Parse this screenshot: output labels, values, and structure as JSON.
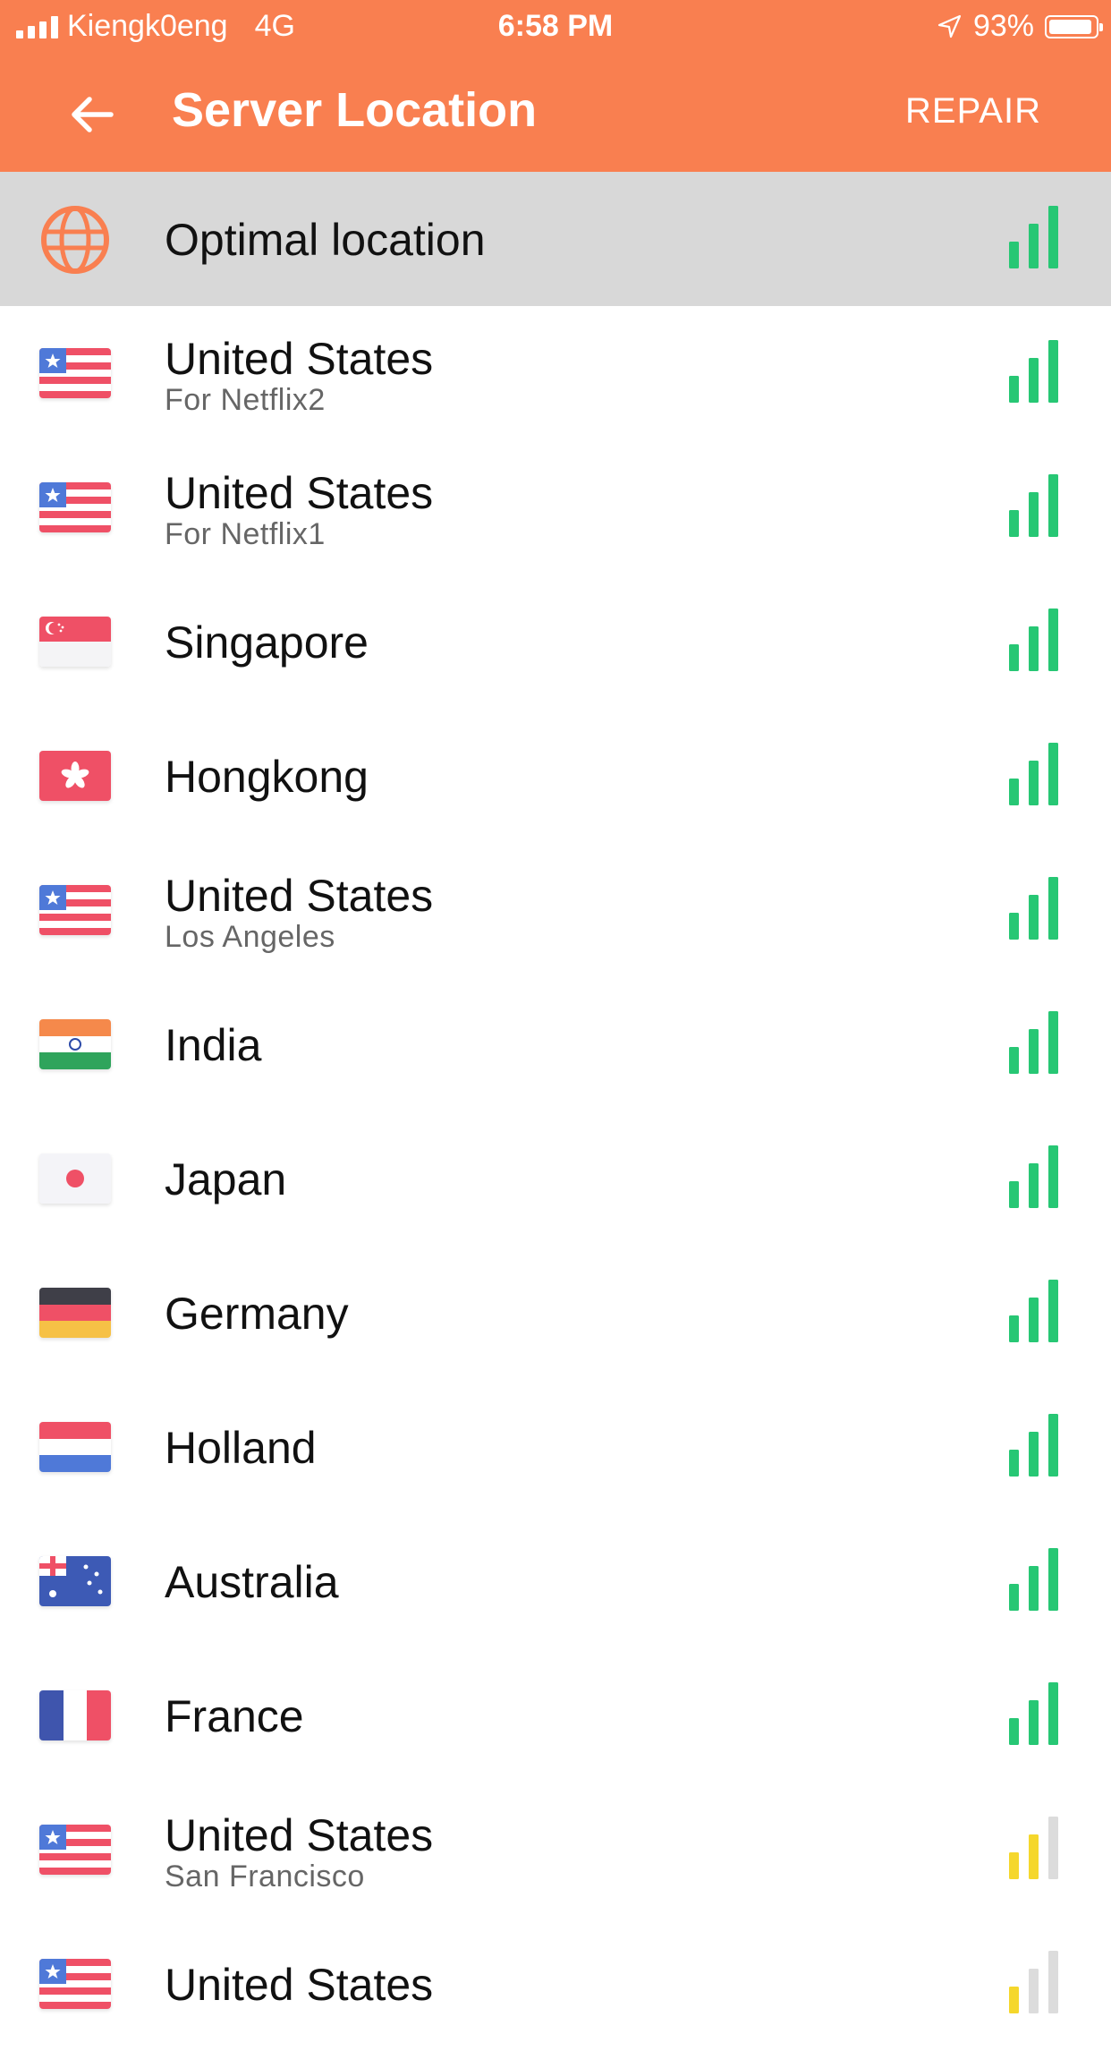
{
  "status_bar": {
    "carrier": "Kiengk0eng",
    "network": "4G",
    "time": "6:58 PM",
    "battery": "93%",
    "battery_level": 0.93
  },
  "header": {
    "title": "Server Location",
    "action": "REPAIR"
  },
  "colors": {
    "accent": "#f97f50",
    "signal_green": "#27c774",
    "signal_yellow": "#f5d72c",
    "signal_off": "#dcdcdc",
    "selected_row": "#d8d8d8"
  },
  "locations": [
    {
      "name": "Optimal location",
      "sub": "",
      "icon": "globe-icon",
      "signal": "good",
      "selected": true
    },
    {
      "name": "United States",
      "sub": "For Netflix2",
      "icon": "us-flag",
      "signal": "good"
    },
    {
      "name": "United States",
      "sub": "For Netflix1",
      "icon": "us-flag",
      "signal": "good"
    },
    {
      "name": "Singapore",
      "sub": "",
      "icon": "singapore-flag",
      "signal": "good"
    },
    {
      "name": "Hongkong",
      "sub": "",
      "icon": "hongkong-flag",
      "signal": "good"
    },
    {
      "name": "United States",
      "sub": "Los Angeles",
      "icon": "us-flag",
      "signal": "good"
    },
    {
      "name": "India",
      "sub": "",
      "icon": "india-flag",
      "signal": "good"
    },
    {
      "name": "Japan",
      "sub": "",
      "icon": "japan-flag",
      "signal": "good"
    },
    {
      "name": "Germany",
      "sub": "",
      "icon": "germany-flag",
      "signal": "good"
    },
    {
      "name": "Holland",
      "sub": "",
      "icon": "holland-flag",
      "signal": "good"
    },
    {
      "name": "Australia",
      "sub": "",
      "icon": "australia-flag",
      "signal": "good"
    },
    {
      "name": "France",
      "sub": "",
      "icon": "france-flag",
      "signal": "good"
    },
    {
      "name": "United States",
      "sub": "San Francisco",
      "icon": "us-flag",
      "signal": "medium"
    },
    {
      "name": "United States",
      "sub": "",
      "icon": "us-flag",
      "signal": "weak"
    }
  ]
}
